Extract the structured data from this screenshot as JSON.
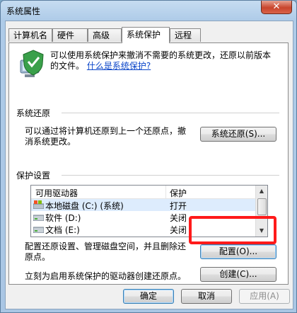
{
  "window": {
    "title": "系统属性",
    "close_glyph": "✕"
  },
  "tabs": [
    {
      "label": "计算机名"
    },
    {
      "label": "硬件"
    },
    {
      "label": "高级"
    },
    {
      "label": "系统保护"
    },
    {
      "label": "远程"
    }
  ],
  "intro": {
    "text": "可以使用系统保护来撤消不需要的系统更改，还原以前版本的文件。",
    "link": "什么是系统保护?"
  },
  "restore": {
    "group_title": "系统还原",
    "description": "可以通过将计算机还原到上一个还原点，撤消系统更改。",
    "button": "系统还原(S)..."
  },
  "protection": {
    "group_title": "保护设置",
    "columns": {
      "drive": "可用驱动器",
      "protect": "保护"
    },
    "rows": [
      {
        "name": "本地磁盘 (C:) (系统)",
        "status": "打开",
        "icon": "system-drive-icon"
      },
      {
        "name": "软件 (D:)",
        "status": "关闭",
        "icon": "drive-icon"
      },
      {
        "name": "文档 (E:)",
        "status": "关闭",
        "icon": "drive-icon"
      }
    ],
    "configure_desc": "配置还原设置、管理磁盘空间，并且删除还原点。",
    "configure_button": "配置(O)...",
    "create_desc": "立刻为启用系统保护的驱动器创建还原点。",
    "create_button": "创建(C)..."
  },
  "footer": {
    "ok": "确定",
    "cancel": "取消",
    "apply": "应用(A)"
  },
  "colors": {
    "highlight": "#ff1a1a",
    "link": "#0a45c9",
    "close": "#c8452c"
  }
}
